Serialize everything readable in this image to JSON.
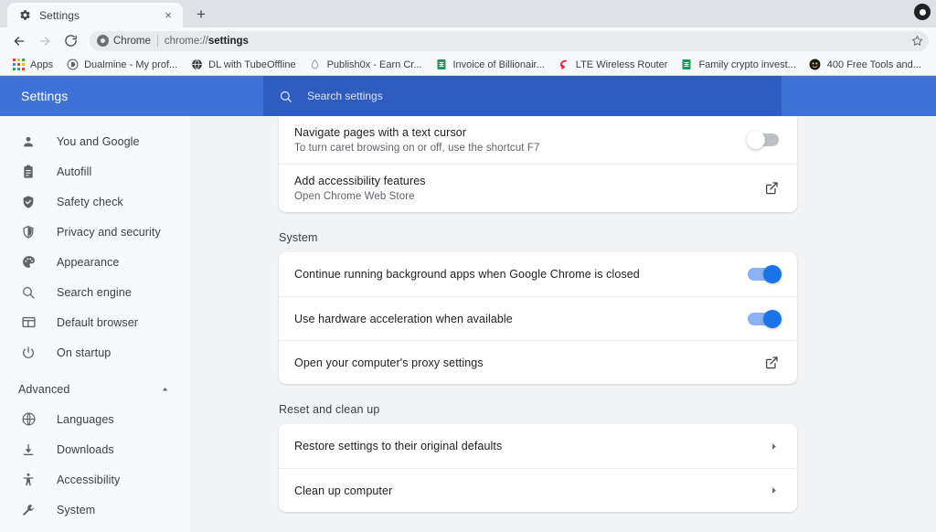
{
  "browser": {
    "tab": {
      "title": "Settings",
      "favicon": "gear-icon",
      "close_label": "×"
    },
    "new_tab_label": "+",
    "toolbar": {
      "back": "←",
      "forward": "→",
      "reload": "↻",
      "omnibox_chip": "Chrome",
      "omnibox_url_prefix": "chrome://",
      "omnibox_url_page": "settings",
      "star": "☆"
    },
    "bookmarks": [
      {
        "label": "Apps",
        "icon": "apps-grid-icon"
      },
      {
        "label": "Dualmine - My prof...",
        "icon": "circle-d-icon"
      },
      {
        "label": "DL with TubeOffline",
        "icon": "globe-dark-icon"
      },
      {
        "label": "Publish0x - Earn Cr...",
        "icon": "water-drop-icon"
      },
      {
        "label": "Invoice of Billionair...",
        "icon": "google-sheets-icon"
      },
      {
        "label": "LTE Wireless Router",
        "icon": "red-swirl-icon"
      },
      {
        "label": "Family crypto invest...",
        "icon": "google-sheets-icon"
      },
      {
        "label": "400 Free Tools and...",
        "icon": "dark-avatar-icon"
      }
    ]
  },
  "settings": {
    "title": "Settings",
    "search": {
      "placeholder": "Search settings",
      "value": ""
    },
    "accent_color": "#3f72d7",
    "search_box_color": "#2f5cbf",
    "sidebar": {
      "items": [
        {
          "label": "You and Google",
          "icon": "person-icon"
        },
        {
          "label": "Autofill",
          "icon": "clipboard-icon"
        },
        {
          "label": "Safety check",
          "icon": "shield-check-icon"
        },
        {
          "label": "Privacy and security",
          "icon": "shield-icon"
        },
        {
          "label": "Appearance",
          "icon": "palette-icon"
        },
        {
          "label": "Search engine",
          "icon": "search-icon"
        },
        {
          "label": "Default browser",
          "icon": "browser-window-icon"
        },
        {
          "label": "On startup",
          "icon": "power-icon"
        }
      ],
      "advanced": {
        "label": "Advanced",
        "chevron": "collapse-chevron-up-icon"
      },
      "advanced_items": [
        {
          "label": "Languages",
          "icon": "globe-icon"
        },
        {
          "label": "Downloads",
          "icon": "download-icon"
        },
        {
          "label": "Accessibility",
          "icon": "accessibility-icon"
        },
        {
          "label": "System",
          "icon": "wrench-icon"
        }
      ]
    },
    "accessibility_card": {
      "rows": [
        {
          "title": "Navigate pages with a text cursor",
          "subtitle": "To turn caret browsing on or off, use the shortcut F7",
          "control": "toggle",
          "state": "off"
        },
        {
          "title": "Add accessibility features",
          "subtitle": "Open Chrome Web Store",
          "control": "external-link"
        }
      ]
    },
    "system_section": {
      "heading": "System",
      "rows": [
        {
          "title": "Continue running background apps when Google Chrome is closed",
          "control": "toggle",
          "state": "on"
        },
        {
          "title": "Use hardware acceleration when available",
          "control": "toggle",
          "state": "on"
        },
        {
          "title": "Open your computer's proxy settings",
          "control": "external-link"
        }
      ]
    },
    "reset_section": {
      "heading": "Reset and clean up",
      "rows": [
        {
          "title": "Restore settings to their original defaults",
          "control": "chevron-right"
        },
        {
          "title": "Clean up computer",
          "control": "chevron-right"
        }
      ]
    }
  }
}
